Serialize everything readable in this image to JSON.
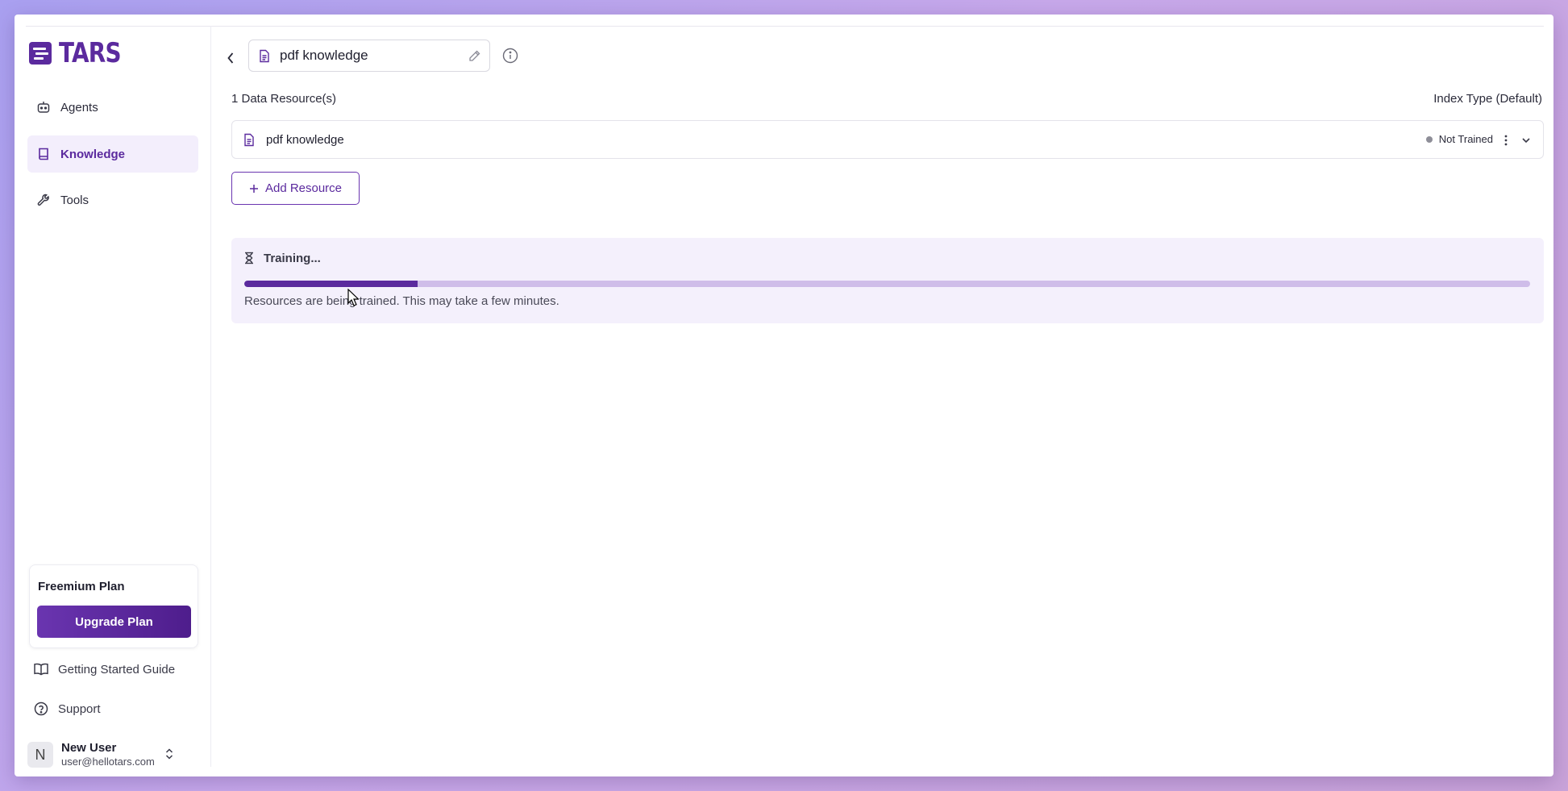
{
  "app": {
    "logo_text": "TARS",
    "brand_color": "#5b2a9e"
  },
  "sidebar": {
    "items": [
      {
        "label": "Agents",
        "icon": "robot-icon",
        "active": false
      },
      {
        "label": "Knowledge",
        "icon": "book-icon",
        "active": true
      },
      {
        "label": "Tools",
        "icon": "wrench-icon",
        "active": false
      }
    ],
    "plan": {
      "title": "Freemium Plan",
      "upgrade_label": "Upgrade Plan"
    },
    "links": [
      {
        "label": "Getting Started Guide",
        "icon": "open-book-icon"
      },
      {
        "label": "Support",
        "icon": "help-circle-icon"
      }
    ],
    "user": {
      "initial": "N",
      "name": "New User",
      "email": "user@hellotars.com"
    }
  },
  "header": {
    "title_value": "pdf knowledge"
  },
  "resources": {
    "count_label": "1 Data Resource(s)",
    "index_type_label": "Index Type (Default)",
    "items": [
      {
        "name": "pdf knowledge",
        "status": "Not Trained",
        "status_color": "#8e8e98"
      }
    ],
    "add_label": "Add Resource"
  },
  "training": {
    "title": "Training...",
    "progress": 0.135,
    "message": "Resources are being trained. This may take a few minutes."
  }
}
